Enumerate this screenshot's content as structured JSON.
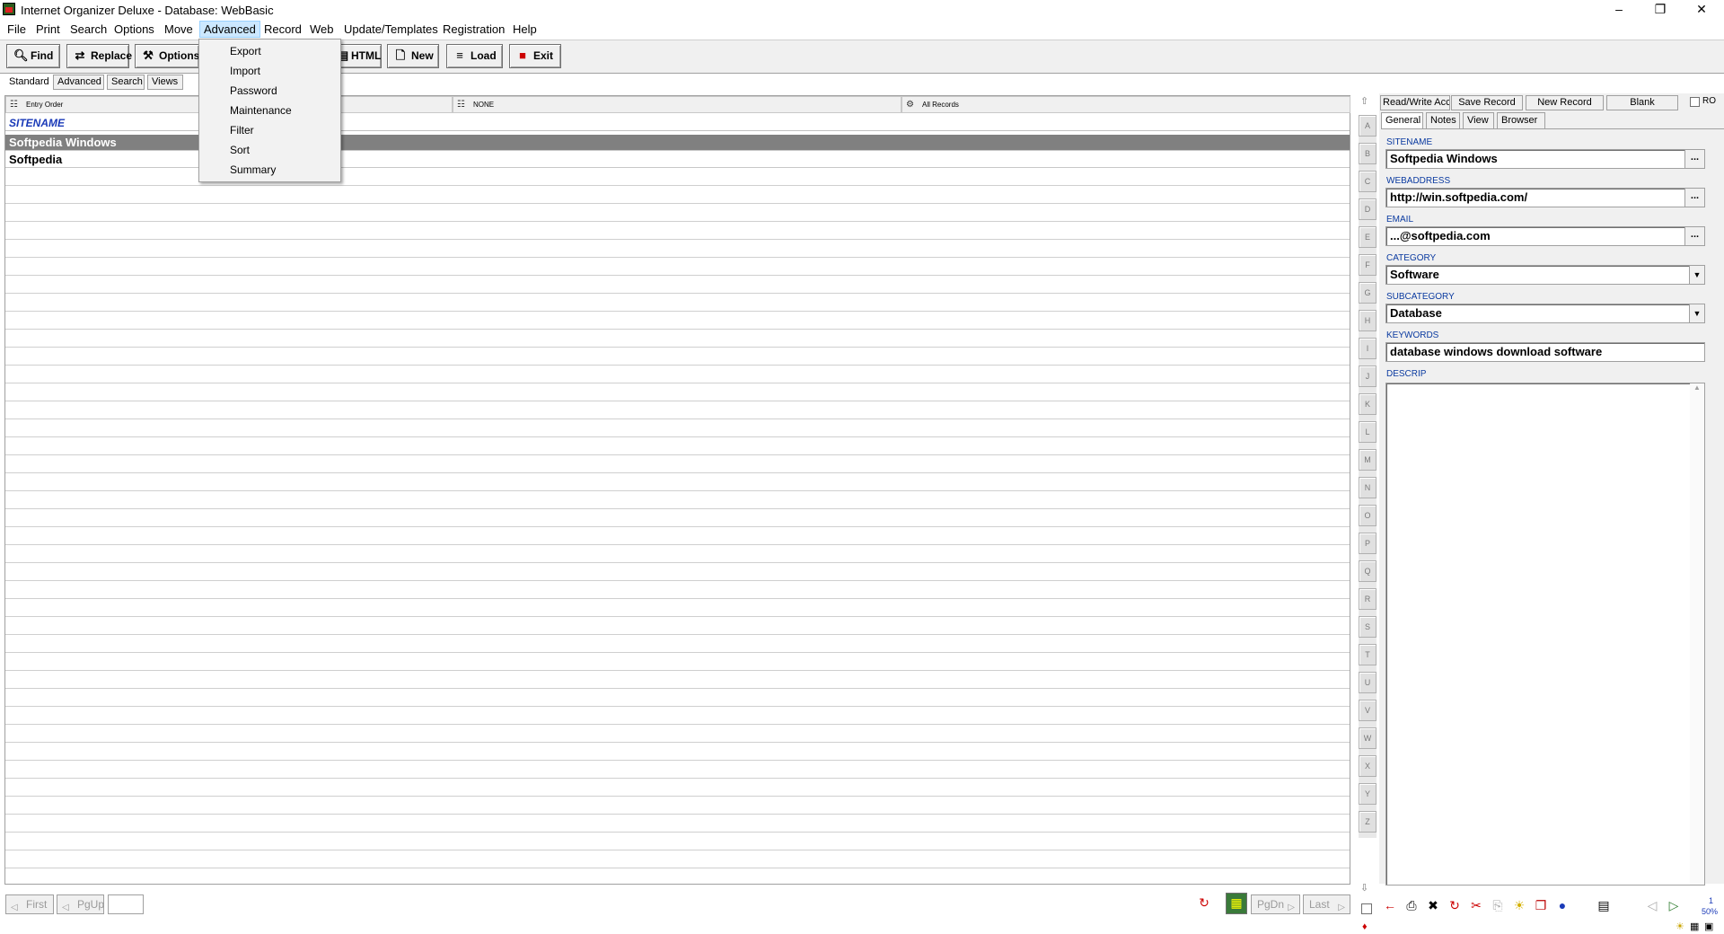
{
  "window": {
    "title": "Internet Organizer Deluxe - Database: WebBasic",
    "controls": [
      "–",
      "❐",
      "✕"
    ]
  },
  "menubar": [
    "File",
    "Print",
    "Search",
    "Options",
    "Move",
    "Advanced",
    "Record",
    "Web",
    "Update/Templates",
    "Registration",
    "Help"
  ],
  "toolbar": {
    "find": "Find",
    "replace": "Replace",
    "options": "Options",
    "html": "HTML",
    "new": "New",
    "load": "Load",
    "exit": "Exit"
  },
  "mode_tabs": [
    "Standard",
    "Advanced",
    "Search",
    "Views"
  ],
  "list": {
    "order_header": "Entry Order",
    "filter_header": "NONE",
    "records_header": "All Records",
    "column_title": "SITENAME",
    "rows": [
      "Softpedia Windows",
      "Softpedia"
    ]
  },
  "dropdown": {
    "items": [
      "Export",
      "Import",
      "Password",
      "Maintenance",
      "Filter",
      "Sort",
      "Summary"
    ]
  },
  "alphabet": [
    "A",
    "B",
    "C",
    "D",
    "E",
    "F",
    "G",
    "H",
    "I",
    "J",
    "K",
    "L",
    "M",
    "N",
    "O",
    "P",
    "Q",
    "R",
    "S",
    "T",
    "U",
    "V",
    "W",
    "X",
    "Y",
    "Z"
  ],
  "nav": {
    "first": "First",
    "pgup": "PgUp",
    "pgdn": "PgDn",
    "last": "Last",
    "page_value": ""
  },
  "record": {
    "access": "Read/Write Acc",
    "save": "Save Record",
    "new": "New Record",
    "blank": "Blank",
    "ro": "RO",
    "tabs": [
      "General",
      "Notes",
      "View",
      "Browser"
    ],
    "fields": {
      "sitename_label": "SITENAME",
      "sitename": "Softpedia Windows",
      "webaddress_label": "WEBADDRESS",
      "webaddress": "http://win.softpedia.com/",
      "email_label": "EMAIL",
      "email": "...@softpedia.com",
      "category_label": "CATEGORY",
      "category": "Software",
      "subcategory_label": "SUBCATEGORY",
      "subcategory": "Database",
      "keywords_label": "KEYWORDS",
      "keywords": "database windows download software",
      "descrip_label": "DESCRIP",
      "descrip": ""
    },
    "ellipsis": "...",
    "zoom": "50%",
    "page_indicator": "1"
  },
  "colors": {
    "label_blue": "#0a3aa0",
    "sitename_blue": "#1a3ab8",
    "selected_row": "#808080",
    "menu_highlight": "#cce8ff"
  }
}
